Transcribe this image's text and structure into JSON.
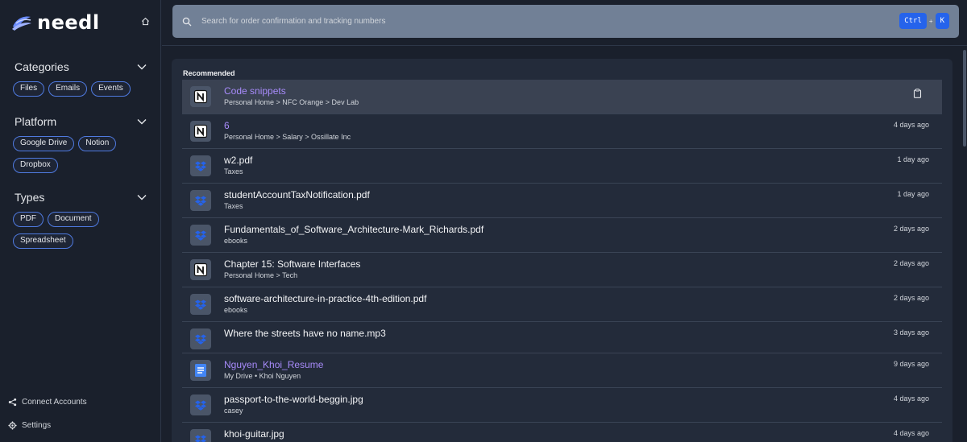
{
  "app": {
    "logo_text": "needl"
  },
  "search": {
    "placeholder": "Search for order confirmation and tracking numbers",
    "shortcut": [
      "Ctrl",
      "K"
    ],
    "plus": "+"
  },
  "sidebar": {
    "categories": {
      "title": "Categories",
      "chips": [
        "Files",
        "Emails",
        "Events"
      ]
    },
    "platform": {
      "title": "Platform",
      "chips": [
        "Google Drive",
        "Notion",
        "Dropbox"
      ]
    },
    "types": {
      "title": "Types",
      "chips": [
        "PDF",
        "Document",
        "Spreadsheet"
      ]
    },
    "footer": {
      "connect": "Connect Accounts",
      "settings": "Settings"
    }
  },
  "main": {
    "section_label": "Recommended",
    "rows": [
      {
        "title": "Code snippets",
        "subtitle": "Personal Home > NFC Orange > Dev Lab",
        "time": "",
        "icon": "notion-icon",
        "link": true,
        "selected": true
      },
      {
        "title": "6",
        "subtitle": "Personal Home > Salary > Ossillate Inc",
        "time": "4 days ago",
        "icon": "notion-icon",
        "link": true
      },
      {
        "title": "w2.pdf",
        "subtitle": "Taxes",
        "time": "1 day ago",
        "icon": "dropbox-icon"
      },
      {
        "title": "studentAccountTaxNotification.pdf",
        "subtitle": "Taxes",
        "time": "1 day ago",
        "icon": "dropbox-icon"
      },
      {
        "title": "Fundamentals_of_Software_Architecture-Mark_Richards.pdf",
        "subtitle": "ebooks",
        "time": "2 days ago",
        "icon": "dropbox-icon"
      },
      {
        "title": "Chapter 15: Software Interfaces",
        "subtitle": "Personal Home > Tech",
        "time": "2 days ago",
        "icon": "notion-icon"
      },
      {
        "title": "software-architecture-in-practice-4th-edition.pdf",
        "subtitle": "ebooks",
        "time": "2 days ago",
        "icon": "dropbox-icon"
      },
      {
        "title": "Where the streets have no name.mp3",
        "subtitle": "",
        "time": "3 days ago",
        "icon": "dropbox-icon"
      },
      {
        "title": "Nguyen_Khoi_Resume",
        "subtitle": "My Drive • Khoi Nguyen",
        "time": "9 days ago",
        "icon": "google-docs-icon",
        "link": true
      },
      {
        "title": "passport-to-the-world-beggin.jpg",
        "subtitle": "casey",
        "time": "4 days ago",
        "icon": "dropbox-icon"
      },
      {
        "title": "khoi-guitar.jpg",
        "subtitle": "",
        "time": "4 days ago",
        "icon": "dropbox-icon"
      }
    ]
  }
}
